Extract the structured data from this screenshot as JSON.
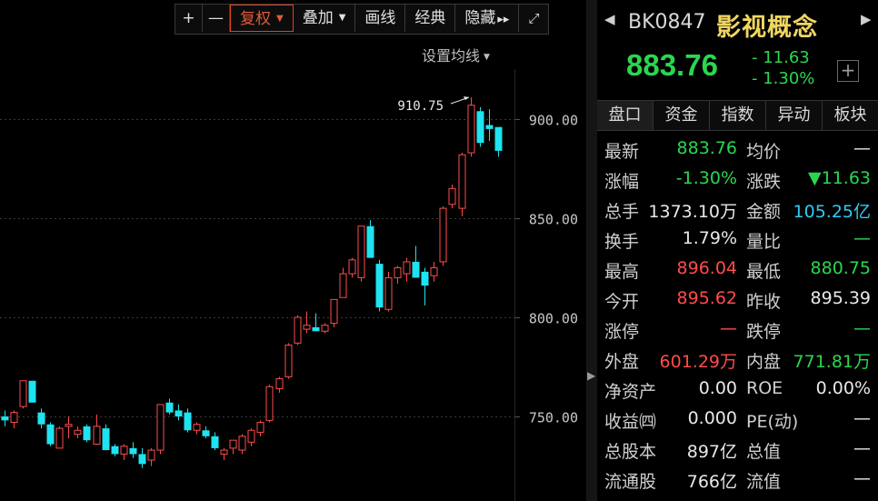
{
  "toolbar": {
    "plus": "+",
    "minus": "—",
    "fuquan": "复权",
    "diejia": "叠加",
    "huaxian": "画线",
    "jingdian": "经典",
    "yincang": "隐藏",
    "yincang_arrows": "▸▸",
    "expand": "⤢"
  },
  "ma_setting": "设置均线",
  "colors": {
    "up": "#ff4b4b",
    "down": "#1ee3f0",
    "up_text": "#ff4b4b",
    "down_text": "#2bd64f",
    "name": "#f0d660"
  },
  "chart_data": {
    "type": "candlestick",
    "y_ticks": [
      "900.00",
      "850.00",
      "800.00",
      "750.00"
    ],
    "y_tick_values": [
      900,
      850,
      800,
      750
    ],
    "high_annotation": "910.75",
    "grid": true,
    "candles": [
      {
        "o": 750,
        "h": 753,
        "l": 745,
        "c": 748
      },
      {
        "o": 747,
        "h": 753,
        "l": 744,
        "c": 752
      },
      {
        "o": 755,
        "h": 768,
        "l": 754,
        "c": 768
      },
      {
        "o": 768,
        "h": 768,
        "l": 757,
        "c": 757
      },
      {
        "o": 752,
        "h": 754,
        "l": 744,
        "c": 746
      },
      {
        "o": 746,
        "h": 747,
        "l": 735,
        "c": 736
      },
      {
        "o": 734,
        "h": 745,
        "l": 734,
        "c": 744
      },
      {
        "o": 745,
        "h": 750,
        "l": 739,
        "c": 746
      },
      {
        "o": 741,
        "h": 745,
        "l": 739,
        "c": 743
      },
      {
        "o": 745,
        "h": 746,
        "l": 737,
        "c": 738
      },
      {
        "o": 736,
        "h": 751,
        "l": 736,
        "c": 745
      },
      {
        "o": 744,
        "h": 746,
        "l": 734,
        "c": 733
      },
      {
        "o": 735,
        "h": 736,
        "l": 730,
        "c": 731
      },
      {
        "o": 731,
        "h": 736,
        "l": 728,
        "c": 735
      },
      {
        "o": 734,
        "h": 737,
        "l": 729,
        "c": 731
      },
      {
        "o": 731,
        "h": 734,
        "l": 724,
        "c": 726
      },
      {
        "o": 728,
        "h": 734,
        "l": 725,
        "c": 733
      },
      {
        "o": 733,
        "h": 756,
        "l": 731,
        "c": 756
      },
      {
        "o": 757,
        "h": 759,
        "l": 751,
        "c": 752
      },
      {
        "o": 753,
        "h": 756,
        "l": 748,
        "c": 750
      },
      {
        "o": 752,
        "h": 754,
        "l": 742,
        "c": 743
      },
      {
        "o": 743,
        "h": 747,
        "l": 741,
        "c": 746
      },
      {
        "o": 743,
        "h": 745,
        "l": 739,
        "c": 740
      },
      {
        "o": 740,
        "h": 742,
        "l": 733,
        "c": 734
      },
      {
        "o": 731,
        "h": 734,
        "l": 728,
        "c": 733
      },
      {
        "o": 734,
        "h": 738,
        "l": 731,
        "c": 738
      },
      {
        "o": 733,
        "h": 741,
        "l": 731,
        "c": 740
      },
      {
        "o": 737,
        "h": 744,
        "l": 735,
        "c": 743
      },
      {
        "o": 742,
        "h": 748,
        "l": 740,
        "c": 747
      },
      {
        "o": 748,
        "h": 766,
        "l": 747,
        "c": 765
      },
      {
        "o": 764,
        "h": 770,
        "l": 762,
        "c": 769
      },
      {
        "o": 770,
        "h": 787,
        "l": 769,
        "c": 786
      },
      {
        "o": 787,
        "h": 801,
        "l": 786,
        "c": 800
      },
      {
        "o": 794,
        "h": 803,
        "l": 792,
        "c": 796
      },
      {
        "o": 795,
        "h": 802,
        "l": 793,
        "c": 793
      },
      {
        "o": 793,
        "h": 797,
        "l": 792,
        "c": 796
      },
      {
        "o": 797,
        "h": 809,
        "l": 795,
        "c": 809
      },
      {
        "o": 810,
        "h": 825,
        "l": 810,
        "c": 822
      },
      {
        "o": 822,
        "h": 830,
        "l": 820,
        "c": 829
      },
      {
        "o": 820,
        "h": 846,
        "l": 818,
        "c": 846
      },
      {
        "o": 846,
        "h": 849,
        "l": 830,
        "c": 830
      },
      {
        "o": 827,
        "h": 829,
        "l": 803,
        "c": 805
      },
      {
        "o": 804,
        "h": 823,
        "l": 803,
        "c": 820
      },
      {
        "o": 820,
        "h": 826,
        "l": 817,
        "c": 825
      },
      {
        "o": 822,
        "h": 830,
        "l": 818,
        "c": 828
      },
      {
        "o": 828,
        "h": 836,
        "l": 820,
        "c": 820
      },
      {
        "o": 823,
        "h": 825,
        "l": 806,
        "c": 816
      },
      {
        "o": 821,
        "h": 828,
        "l": 818,
        "c": 825
      },
      {
        "o": 828,
        "h": 856,
        "l": 826,
        "c": 855
      },
      {
        "o": 857,
        "h": 867,
        "l": 855,
        "c": 865
      },
      {
        "o": 855,
        "h": 883,
        "l": 851,
        "c": 882
      },
      {
        "o": 883,
        "h": 911,
        "l": 881,
        "c": 907
      },
      {
        "o": 904,
        "h": 906,
        "l": 886,
        "c": 888
      },
      {
        "o": 897,
        "h": 905,
        "l": 889,
        "c": 895
      },
      {
        "o": 896,
        "h": 896,
        "l": 881,
        "c": 884
      }
    ]
  },
  "header": {
    "prev": "◀",
    "next": "▶",
    "code": "BK0847",
    "name": "影视概念",
    "price": "883.76",
    "change": "- 11.63",
    "change_pct": "- 1.30%",
    "add": "+"
  },
  "tabs": [
    "盘口",
    "资金",
    "指数",
    "异动",
    "板块"
  ],
  "stats": [
    {
      "l": "最新",
      "lv": "883.76",
      "lc": "green",
      "r": "均价",
      "rv": "—",
      "rc": "white"
    },
    {
      "l": "涨幅",
      "lv": "-1.30%",
      "lc": "green",
      "r": "涨跌",
      "rv": "▼11.63",
      "rc": "green"
    },
    {
      "l": "总手",
      "lv": "1373.10万",
      "lc": "white",
      "r": "金额",
      "rv": "105.25亿",
      "rc": "cyan"
    },
    {
      "l": "换手",
      "lv": "1.79%",
      "lc": "white",
      "r": "量比",
      "rv": "—",
      "rc": "green"
    },
    {
      "l": "最高",
      "lv": "896.04",
      "lc": "red",
      "r": "最低",
      "rv": "880.75",
      "rc": "green"
    },
    {
      "l": "今开",
      "lv": "895.62",
      "lc": "red",
      "r": "昨收",
      "rv": "895.39",
      "rc": "white"
    },
    {
      "l": "涨停",
      "lv": "—",
      "lc": "red",
      "r": "跌停",
      "rv": "—",
      "rc": "green"
    },
    {
      "l": "外盘",
      "lv": "601.29万",
      "lc": "red",
      "r": "内盘",
      "rv": "771.81万",
      "rc": "green"
    },
    {
      "l": "净资产",
      "lv": "0.00",
      "lc": "white",
      "r": "ROE",
      "rv": "0.00%",
      "rc": "white"
    },
    {
      "l": "收益㈣",
      "lv": "0.000",
      "lc": "white",
      "r": "PE(动)",
      "rv": "—",
      "rc": "white"
    },
    {
      "l": "总股本",
      "lv": "897亿",
      "lc": "white",
      "r": "总值",
      "rv": "—",
      "rc": "white"
    },
    {
      "l": "流通股",
      "lv": "766亿",
      "lc": "white",
      "r": "流值",
      "rv": "—",
      "rc": "white"
    }
  ]
}
